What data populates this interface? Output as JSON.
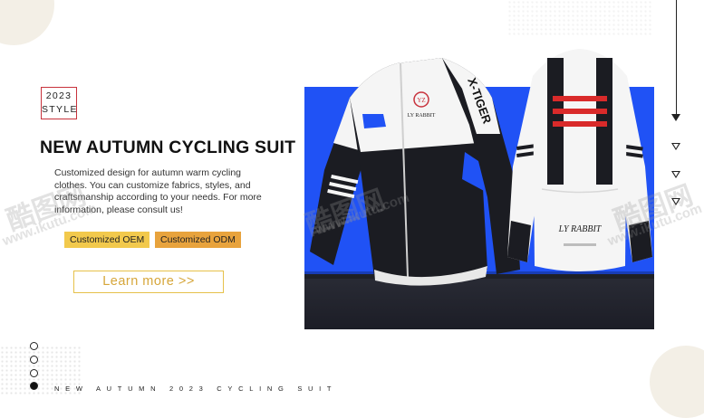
{
  "badge": {
    "year": "2023",
    "label": "STYLE"
  },
  "title": "NEW AUTUMN CYCLING SUIT",
  "description": "Customized design for autumn warm cycling clothes. You can customize fabrics, styles, and craftsmanship according to your needs. For more information, please consult us!",
  "tags": {
    "oem": "Customized OEM",
    "odm": "Customized ODM"
  },
  "cta": {
    "label": "Learn more  >>"
  },
  "product": {
    "front_brand_text": "X-TIGER",
    "front_logo_text": "LY RABBIT",
    "front_logo_mark": "YZ",
    "back_logo_text": "LY RABBIT",
    "accent_color": "#2052f5",
    "dark_color": "#1b1c22"
  },
  "watermark": {
    "cn": "酷图网",
    "url": "www.ikutu.com"
  },
  "slides": {
    "count": 4,
    "active_index": 3
  },
  "footer": "NEW AUTUMN 2023 CYCLING SUIT"
}
